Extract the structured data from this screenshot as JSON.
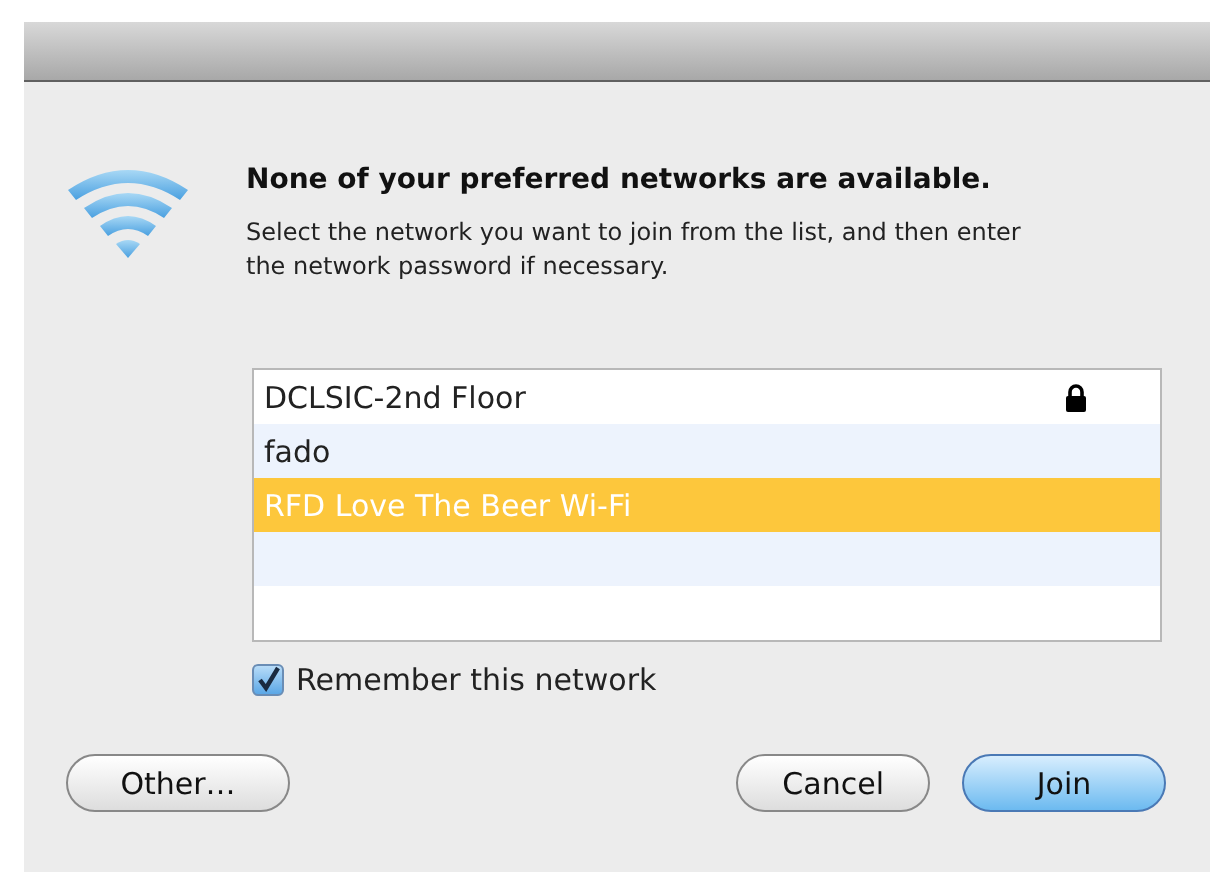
{
  "dialog": {
    "heading": "None of your preferred networks are available.",
    "message": "Select the network you want to join from the list, and then enter the network password if necessary."
  },
  "networks": [
    {
      "name": "DCLSIC-2nd Floor",
      "locked": true,
      "selected": false
    },
    {
      "name": "fado",
      "locked": false,
      "selected": false
    },
    {
      "name": "RFD Love The Beer Wi-Fi",
      "locked": false,
      "selected": true
    }
  ],
  "remember": {
    "label": "Remember this network",
    "checked": true
  },
  "buttons": [
    {
      "label": "Other…",
      "kind": "plain"
    },
    {
      "label": "Cancel",
      "kind": "plain"
    },
    {
      "label": "Join",
      "kind": "default"
    }
  ]
}
